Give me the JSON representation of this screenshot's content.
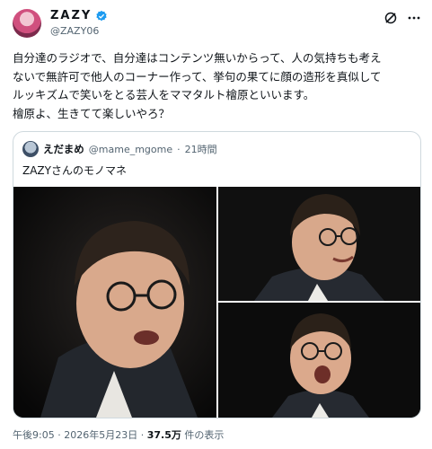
{
  "author": {
    "display_name": "ZAZY",
    "handle": "@ZAZY06",
    "verified": true,
    "avatar_icon": "profile-avatar-pink"
  },
  "header_icons": [
    "grok-icon",
    "more-options-icon"
  ],
  "post": {
    "lines": [
      "自分達のラジオで、自分達はコンテンツ無いからって、人の気持ちも考え",
      "ないで無許可で他人のコーナー作って、挙句の果てに顔の造形を真似して",
      "ルッキズムで笑いをとる芸人をママタルト檜原といいます。",
      "檜原よ、生きてて楽しいやろ？"
    ]
  },
  "quoted": {
    "name": "えだまめ",
    "handle": "@mame_mgome",
    "separator": "·",
    "time": "21時間",
    "text": "ZAZYさんのモノマネ",
    "media_count": 3
  },
  "footer": {
    "time": "午後9:05",
    "separator": "·",
    "date": "2026年5月23日",
    "separator2": "·",
    "views_count": "37.5万",
    "views_label": "件の表示"
  },
  "colors": {
    "text": "#0f1419",
    "muted": "#536471",
    "border": "#cfd9de",
    "verified": "#1d9bf0"
  }
}
